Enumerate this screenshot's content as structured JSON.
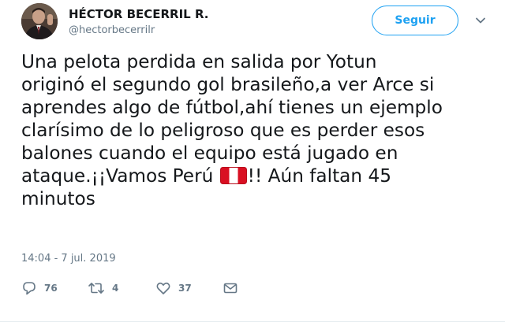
{
  "user": {
    "display_name": "HÉCTOR BECERRIL R.",
    "handle": "@hectorbecerrilr"
  },
  "follow_button": {
    "label": "Seguir"
  },
  "tweet": {
    "lines": [
      "Una pelota perdida en salida por Yotun",
      "originó el segundo gol brasileño,a ver Arce si",
      "aprendes algo de fútbol,ahí tienes un ejemplo",
      "clarísimo de lo peligroso que es perder esos",
      "balones cuando el equipo está jugado en"
    ],
    "line6_before_flag": "ataque.¡¡Vamos Perú ",
    "line6_after_flag": "!! Aún faltan 45",
    "line7": "minutos",
    "emoji": "peru-flag"
  },
  "timestamp": "14:04 - 7 jul. 2019",
  "actions": {
    "reply_count": "76",
    "retweet_count": "4",
    "like_count": "37"
  },
  "colors": {
    "accent": "#1da1f2",
    "text": "#14171a",
    "muted": "#657786",
    "flag_red": "#d91023"
  }
}
